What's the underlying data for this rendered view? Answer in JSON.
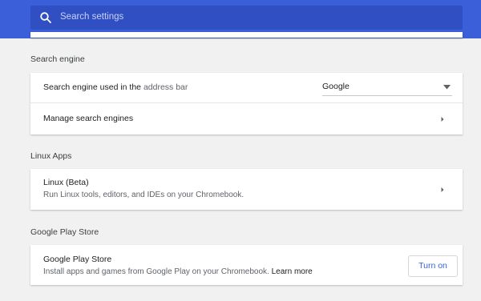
{
  "header": {
    "search_placeholder": "Search settings"
  },
  "search_engine": {
    "section_title": "Search engine",
    "used_label_prefix": "Search engine used in the ",
    "used_label_link": "address bar",
    "selected_engine": "Google",
    "manage_label": "Manage search engines"
  },
  "linux_apps": {
    "section_title": "Linux Apps",
    "item_title": "Linux (Beta)",
    "item_subtitle": "Run Linux tools, editors, and IDEs on your Chromebook."
  },
  "play_store": {
    "section_title": "Google Play Store",
    "item_title": "Google Play Store",
    "item_subtitle": "Install apps and games from Google Play on your Chromebook.",
    "learn_more": "Learn more",
    "button_label": "Turn on"
  },
  "colors": {
    "header": "#3b5fd9",
    "page_background": "#f1f1f1",
    "accent": "#3367d6"
  }
}
